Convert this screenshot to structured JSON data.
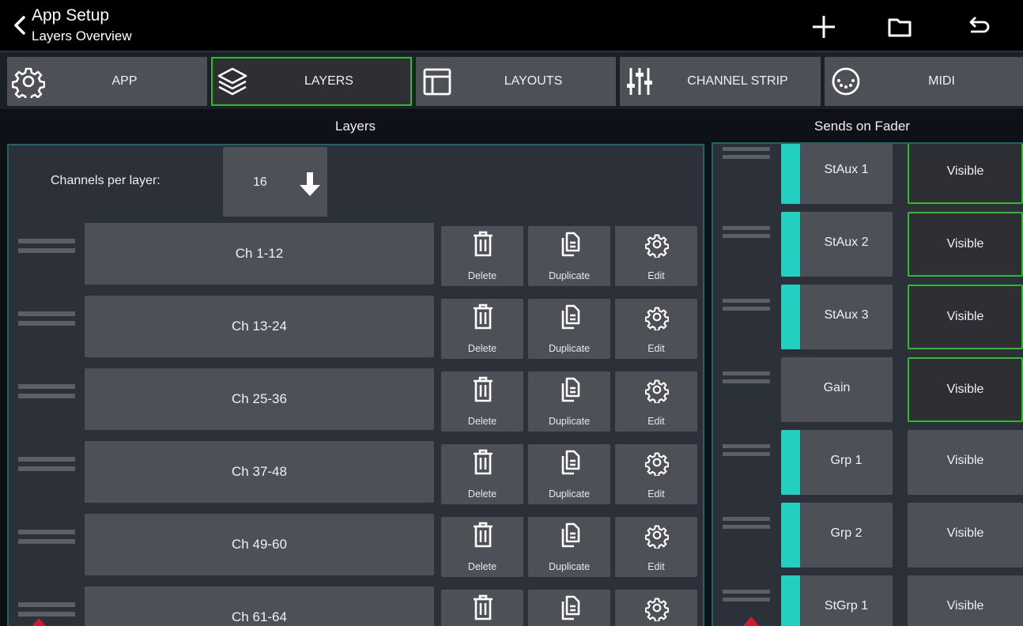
{
  "header": {
    "title": "App Setup",
    "subtitle": "Layers Overview",
    "icons": [
      "back-chevron-icon",
      "plus-icon",
      "folder-icon",
      "undo-icon"
    ]
  },
  "tabs": [
    {
      "label": "APP",
      "icon": "gear-icon",
      "active": false
    },
    {
      "label": "LAYERS",
      "icon": "layers-icon",
      "active": true
    },
    {
      "label": "LAYOUTS",
      "icon": "layout-icon",
      "active": false
    },
    {
      "label": "CHANNEL STRIP",
      "icon": "sliders-icon",
      "active": false
    },
    {
      "label": "MIDI",
      "icon": "midi-connector-icon",
      "active": false
    }
  ],
  "layers_section": {
    "title": "Layers",
    "channels_per_layer_label": "Channels per layer:",
    "channels_per_layer_value": "16",
    "actions": {
      "delete": "Delete",
      "duplicate": "Duplicate",
      "edit": "Edit"
    },
    "layers": [
      "Ch 1-12",
      "Ch 13-24",
      "Ch 25-36",
      "Ch 37-48",
      "Ch 49-60",
      "Ch 61-64"
    ]
  },
  "sends_section": {
    "title": "Sends on Fader",
    "sends": [
      {
        "name": "StAux 1",
        "visibility": "Visible",
        "active": true,
        "teal": true
      },
      {
        "name": "StAux 2",
        "visibility": "Visible",
        "active": true,
        "teal": true
      },
      {
        "name": "StAux 3",
        "visibility": "Visible",
        "active": true,
        "teal": true
      },
      {
        "name": "Gain",
        "visibility": "Visible",
        "active": true,
        "teal": false
      },
      {
        "name": "Grp 1",
        "visibility": "Visible",
        "active": false,
        "teal": true
      },
      {
        "name": "Grp 2",
        "visibility": "Visible",
        "active": false,
        "teal": true
      },
      {
        "name": "StGrp 1",
        "visibility": "Visible",
        "active": false,
        "teal": true
      }
    ]
  },
  "colors": {
    "accent_green": "#2bbb2b",
    "teal": "#22cfc0",
    "button_grey": "#4e5058",
    "panel": "#2b3039",
    "drop_marker_red": "#e0112b"
  }
}
